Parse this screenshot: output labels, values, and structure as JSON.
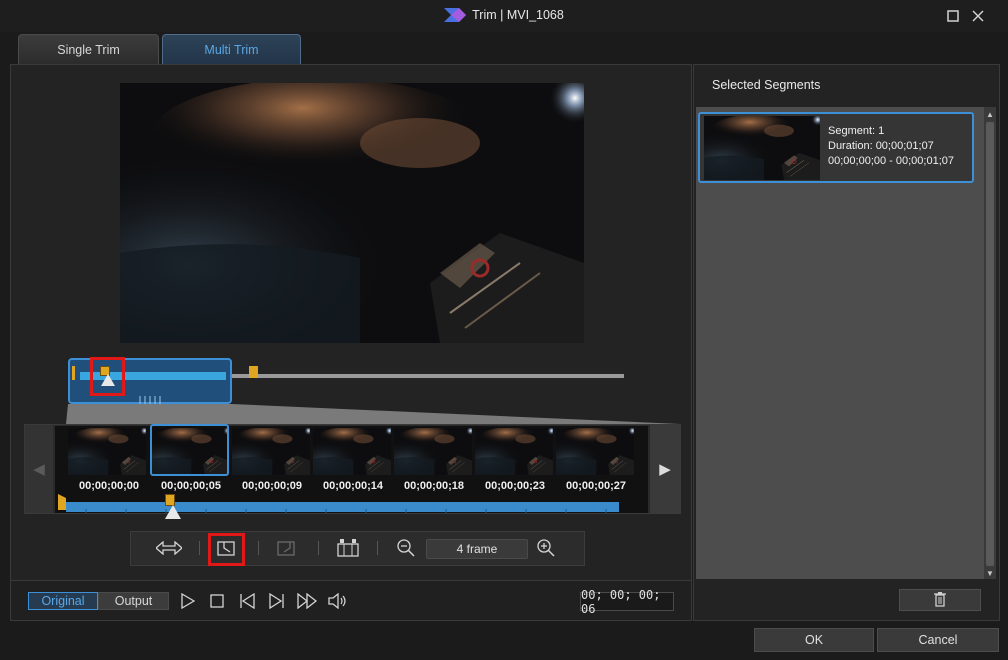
{
  "window": {
    "title": "Trim | MVI_1068",
    "logo_icon": "app-logo-icon",
    "maximize_icon": "maximize-icon",
    "close_icon": "close-icon"
  },
  "tabs": [
    {
      "label": "Single Trim",
      "active": false
    },
    {
      "label": "Multi Trim",
      "active": true
    }
  ],
  "filmstrip": {
    "timecodes": [
      "00;00;00;00",
      "00;00;00;05",
      "00;00;00;09",
      "00;00;00;14",
      "00;00;00;18",
      "00;00;00;23",
      "00;00;00;27"
    ],
    "selected_index": 1,
    "prev_icon": "chevron-left-icon",
    "next_icon": "chevron-right-icon"
  },
  "toolbar": {
    "icons": [
      "swap-arrows-icon",
      "mark-in-icon",
      "mark-out-icon",
      "detect-scenes-icon",
      "zoom-out-icon",
      "zoom-in-icon"
    ],
    "zoom_value": "4 frame"
  },
  "player": {
    "original_label": "Original",
    "output_label": "Output",
    "icons": [
      "play-icon",
      "stop-icon",
      "previous-frame-icon",
      "next-frame-icon",
      "fast-forward-icon",
      "volume-icon"
    ],
    "timecode": "00; 00; 00; 06"
  },
  "selected_segments": {
    "title": "Selected Segments",
    "items": [
      {
        "segment_line": "Segment: 1",
        "duration_line": "Duration: 00;00;01;07",
        "range_line": "00;00;00;00 - 00;00;01;07"
      }
    ],
    "delete_icon": "trash-icon"
  },
  "dialog": {
    "ok_label": "OK",
    "cancel_label": "Cancel"
  },
  "colors": {
    "accent": "#3d8fd6",
    "marker": "#e0a521",
    "highlight": "#e01818"
  }
}
